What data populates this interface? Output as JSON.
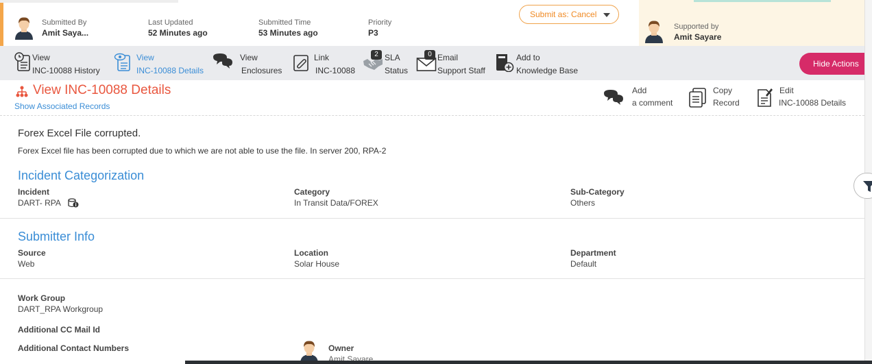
{
  "header": {
    "submitted_by": {
      "label": "Submitted By",
      "value": "Amit Saya..."
    },
    "last_updated": {
      "label": "Last Updated",
      "value": "52 Minutes ago"
    },
    "submitted_time": {
      "label": "Submitted Time",
      "value": "53 Minutes ago"
    },
    "priority": {
      "label": "Priority",
      "value": "P3"
    },
    "submit_button": "Submit as: Cancel",
    "supported_by": {
      "label": "Supported by",
      "value": "Amit Sayare"
    }
  },
  "actions": {
    "history": {
      "line1": "View",
      "line2": "INC-10088 History"
    },
    "details": {
      "line1": "View",
      "line2": "INC-10088 Details"
    },
    "enclosures": {
      "line1": "View",
      "line2": "Enclosures"
    },
    "link": {
      "line1": "Link",
      "line2": "INC-10088"
    },
    "sla": {
      "line1": "SLA",
      "line2": "Status",
      "badge": "2"
    },
    "email": {
      "line1": "Email",
      "line2": "Support Staff",
      "badge": "0"
    },
    "kb": {
      "line1": "Add to",
      "line2": "Knowledge Base"
    },
    "hide": "Hide Actions"
  },
  "page": {
    "title": "View INC-10088 Details",
    "assoc_link": "Show Associated Records",
    "add_comment": {
      "line1": "Add",
      "line2": "a comment"
    },
    "copy_record": {
      "line1": "Copy",
      "line2": "Record"
    },
    "edit": {
      "line1": "Edit",
      "line2": "INC-10088 Details"
    }
  },
  "ticket": {
    "summary": "Forex Excel File corrupted.",
    "description": "Forex Excel file has been corrupted due to which we are not able to use the file. In server 200, RPA-2"
  },
  "categorization": {
    "title": "Incident Categorization",
    "incident": {
      "label": "Incident",
      "value": "DART- RPA"
    },
    "category": {
      "label": "Category",
      "value": "In Transit Data/FOREX"
    },
    "subcategory": {
      "label": "Sub-Category",
      "value": "Others"
    }
  },
  "submitter": {
    "title": "Submitter Info",
    "source": {
      "label": "Source",
      "value": "Web"
    },
    "location": {
      "label": "Location",
      "value": "Solar House"
    },
    "department": {
      "label": "Department",
      "value": "Default"
    }
  },
  "assignment": {
    "work_group": {
      "label": "Work Group",
      "value": "DART_RPA Workgroup"
    },
    "cc_mail": {
      "label": "Additional CC Mail Id"
    },
    "contact_numbers": {
      "label": "Additional Contact Numbers"
    },
    "owner": {
      "label": "Owner",
      "value": "Amit Sayare"
    }
  },
  "colors": {
    "accent_orange": "#f08a24",
    "link_blue": "#3a8dd6",
    "title_red": "#e9573f",
    "hide_pink": "#d62b68"
  }
}
